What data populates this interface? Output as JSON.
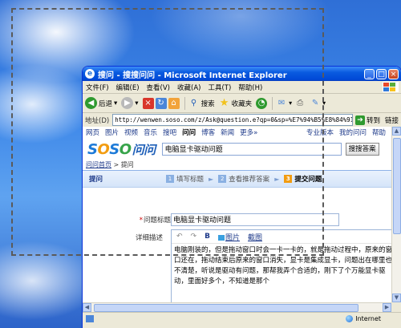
{
  "window": {
    "title": "搜问 - 搜搜问问 - Microsoft Internet Explorer"
  },
  "menu": [
    "文件(F)",
    "编辑(E)",
    "查看(V)",
    "收藏(A)",
    "工具(T)",
    "帮助(H)"
  ],
  "toolbar": {
    "back": "后退",
    "search": "搜索",
    "favorites": "收藏夹"
  },
  "address": {
    "label": "地址(D)",
    "url": "http://wenwen.soso.com/z/Ask@question.e?qp=0&sp=%E7%94%B5%E8%84%91%E6",
    "go": "转到",
    "links": "链接"
  },
  "site": {
    "nav": [
      "网页",
      "图片",
      "视频",
      "音乐",
      "搜吧",
      "问问",
      "博客",
      "新闻",
      "更多»"
    ],
    "nav_active": "问问",
    "nav_right": [
      "专业版本",
      "我的问问",
      "帮助"
    ],
    "logo_parts": [
      "S",
      "O",
      "S",
      "O",
      "问问"
    ],
    "search_value": "电脑显卡驱动问题",
    "search_button": "搜搜答案",
    "breadcrumb_home": "问问首页",
    "breadcrumb_current": "提问",
    "step_header": "提问",
    "steps": [
      {
        "num": "1",
        "label": "填写标题"
      },
      {
        "num": "2",
        "label": "查看推荐答案"
      },
      {
        "num": "3",
        "label": "提交问题"
      }
    ]
  },
  "form": {
    "title_label": "问题标题",
    "title_value": "电脑显卡驱动问题",
    "detail_label": "详细描述",
    "editor_tools": {
      "undo": "↶",
      "redo": "↷",
      "bold": "B",
      "image": "图片",
      "table": "截图"
    },
    "detail_text": "电脑刚装的，但是拖动窗口时会一卡一卡的，就是拖动过程中，原来的窗口还在，拖动结束后原来的窗口消失，显卡是集成显卡，问题出在哪里也不清楚，听说是驱动有问题，那帮我弄个合适的，刚下了个万能显卡驱动，里面好多个，不知道是那个"
  },
  "status": {
    "zone": "Internet"
  }
}
